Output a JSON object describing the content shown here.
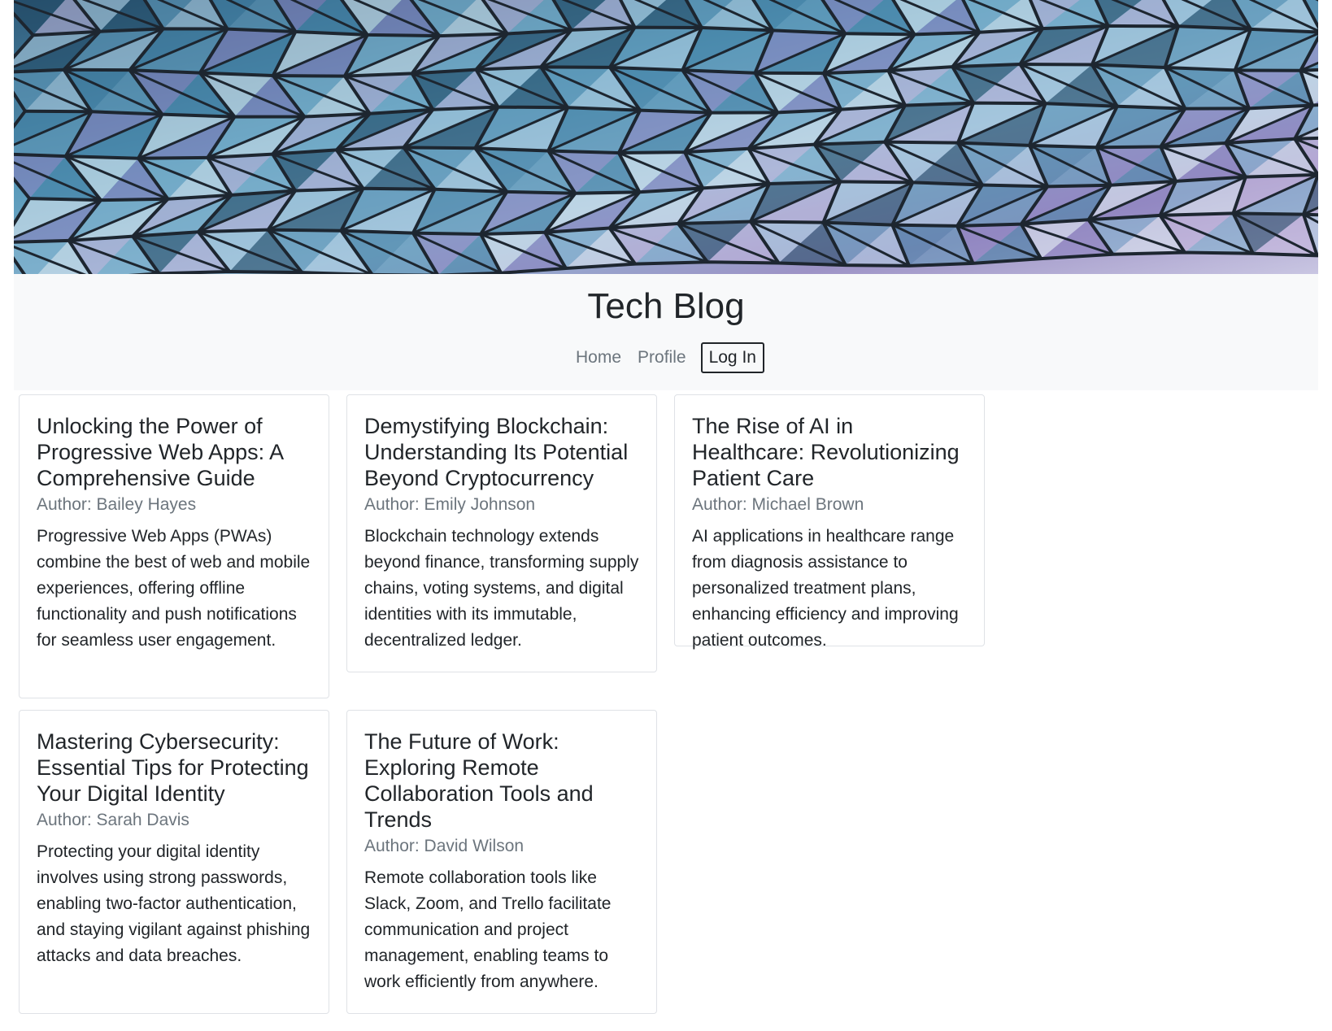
{
  "header": {
    "site_title": "Tech Blog",
    "nav": {
      "home": "Home",
      "profile": "Profile",
      "login": "Log In"
    }
  },
  "posts": [
    {
      "title": "Unlocking the Power of Progressive Web Apps: A Comprehensive Guide",
      "author": "Author: Bailey Hayes",
      "summary": "Progressive Web Apps (PWAs) combine the best of web and mobile experiences, offering offline functionality and push notifications for seamless user engagement."
    },
    {
      "title": "Demystifying Blockchain: Understanding Its Potential Beyond Cryptocurrency",
      "author": "Author: Emily Johnson",
      "summary": "Blockchain technology extends beyond finance, transforming supply chains, voting systems, and digital identities with its immutable, decentralized ledger."
    },
    {
      "title": "The Rise of AI in Healthcare: Revolutionizing Patient Care",
      "author": "Author: Michael Brown",
      "summary": "AI applications in healthcare range from diagnosis assistance to personalized treatment plans, enhancing efficiency and improving patient outcomes."
    },
    {
      "title": "Mastering Cybersecurity: Essential Tips for Protecting Your Digital Identity",
      "author": "Author: Sarah Davis",
      "summary": "Protecting your digital identity involves using strong passwords, enabling two-factor authentication, and staying vigilant against phishing attacks and data breaches."
    },
    {
      "title": "The Future of Work: Exploring Remote Collaboration Tools and Trends",
      "author": "Author: David Wilson",
      "summary": "Remote collaboration tools like Slack, Zoom, and Trello facilitate communication and project management, enabling teams to work efficiently from anywhere."
    }
  ],
  "colors": {
    "masthead_bg": "#f8f9fa",
    "muted_text": "#6c757d",
    "body_text": "#212529",
    "card_border": "#dfe2e6"
  }
}
